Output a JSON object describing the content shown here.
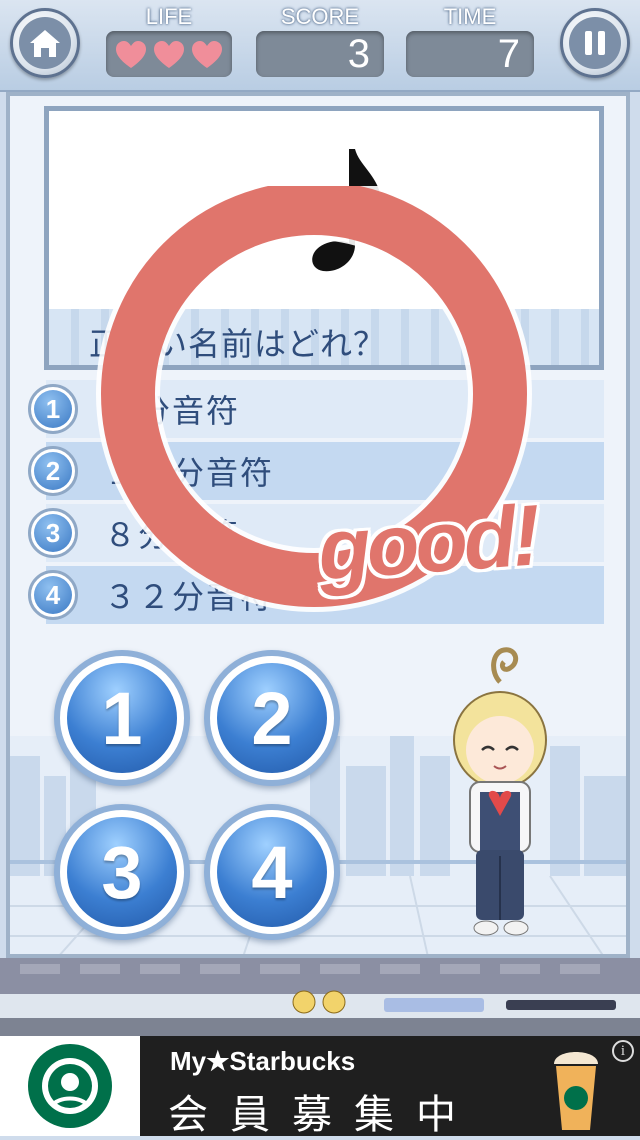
{
  "hud": {
    "life_label": "LIFE",
    "score_label": "SCORE",
    "score_value": "3",
    "time_label": "TIME",
    "time_value": "7",
    "lives_remaining": 3,
    "lives_max": 3
  },
  "question": {
    "text": "正しい名前はどれ？",
    "symbol": "eighth-note-icon"
  },
  "answers": [
    {
      "number": "1",
      "label": "４分音符"
    },
    {
      "number": "2",
      "label": "１６分音符"
    },
    {
      "number": "3",
      "label": "８分音符"
    },
    {
      "number": "4",
      "label": "３２分音符"
    }
  ],
  "answer_buttons": [
    "1",
    "2",
    "3",
    "4"
  ],
  "feedback": {
    "text": "good!",
    "symbol": "correct-circle-icon"
  },
  "ad": {
    "title": "My★Starbucks",
    "subtitle": "会員募集中",
    "info": "i"
  },
  "colors": {
    "accent_blue": "#3c7fd2",
    "correct_red": "#e0756c",
    "heart_pink": "#f08e9a"
  }
}
